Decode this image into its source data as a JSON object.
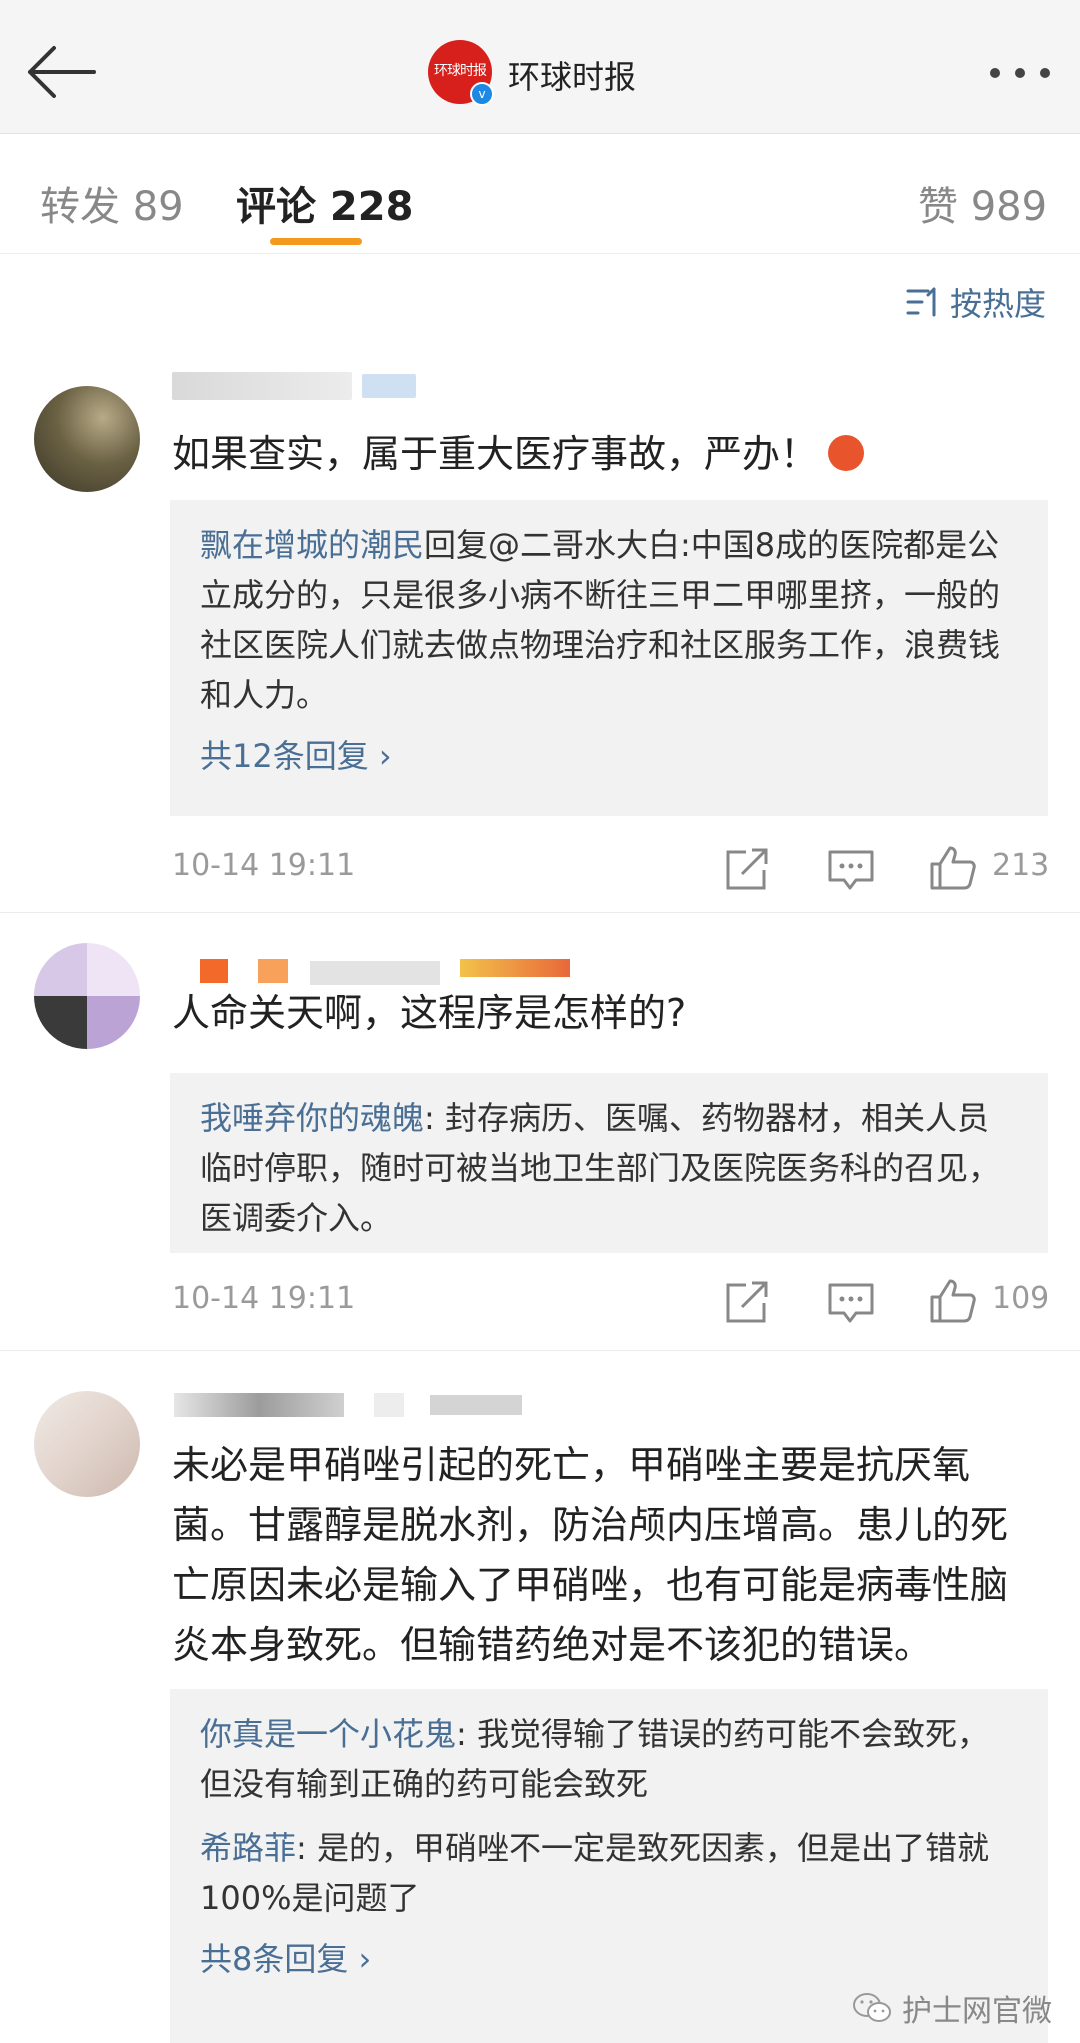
{
  "header": {
    "account_name": "环球时报",
    "logo_text": "环球时报"
  },
  "tabs": [
    {
      "label": "转发 89"
    },
    {
      "label": "评论 228"
    },
    {
      "label": "赞 989"
    }
  ],
  "sort": {
    "label": "按热度"
  },
  "comments": [
    {
      "text": "如果查实，属于重大医疗事故，严办！",
      "replies": [
        {
          "user": "飘在增城的潮民",
          "text": "回复@二哥水大白:中国8成的医院都是公立成分的，只是很多小病不断往三甲二甲哪里挤，一般的社区医院人们就去做点物理治疗和社区服务工作，浪费钱和人力。"
        }
      ],
      "more_replies": "共12条回复 ›",
      "time": "10-14 19:11",
      "likes": "213"
    },
    {
      "text": "人命关天啊，这程序是怎样的?",
      "replies": [
        {
          "user": "我唾弃你的魂魄",
          "text": ": 封存病历、医嘱、药物器材，相关人员临时停职，随时可被当地卫生部门及医院医务科的召见，医调委介入。"
        }
      ],
      "time": "10-14 19:11",
      "likes": "109"
    },
    {
      "text": "未必是甲硝唑引起的死亡，甲硝唑主要是抗厌氧菌。甘露醇是脱水剂，防治颅内压增高。患儿的死亡原因未必是输入了甲硝唑，也有可能是病毒性脑炎本身致死。但输错药绝对是不该犯的错误。",
      "replies": [
        {
          "user": "你真是一个小花鬼",
          "text": ": 我觉得输了错误的药可能不会致死，但没有输到正确的药可能会致死"
        },
        {
          "user": "希路菲",
          "text": ": 是的，甲硝唑不一定是致死因素，但是出了错就100%是问题了"
        }
      ],
      "more_replies": "共8条回复 ›"
    }
  ],
  "watermark": {
    "text": "护士网官微"
  },
  "icons": {
    "back": "back-arrow-icon",
    "more": "more-dots-icon",
    "sort": "sort-icon",
    "repost": "repost-icon",
    "comment": "comment-icon",
    "like": "thumbs-up-icon"
  },
  "colors": {
    "accent": "#f39a1e",
    "link": "#4a6f95",
    "verified": "#1e88e5",
    "brand": "#d7201c"
  }
}
